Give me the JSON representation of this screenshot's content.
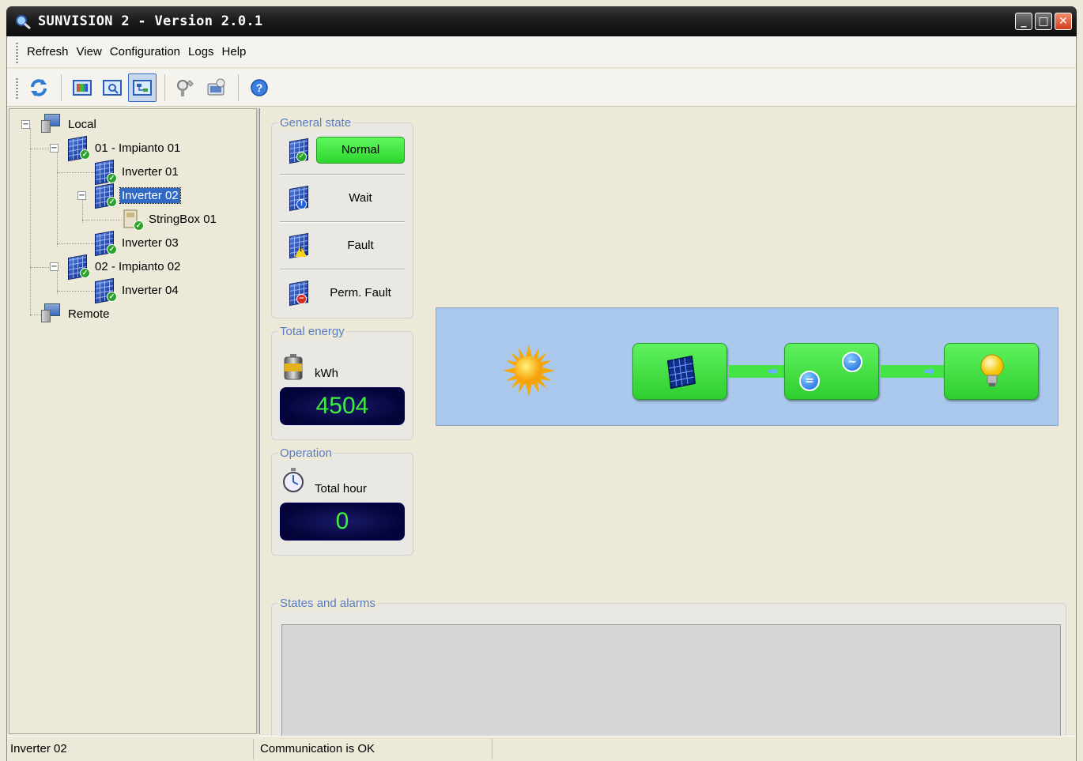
{
  "window": {
    "title": "SUNVISION 2 - Version 2.0.1",
    "buttons": {
      "minimize": "_",
      "maximize": "□",
      "close": "✕"
    }
  },
  "menu": [
    "Refresh",
    "View",
    "Configuration",
    "Logs",
    "Help"
  ],
  "toolbar": {
    "icons": [
      "refresh-icon",
      "view-panel-icon",
      "view-detail-icon",
      "view-tree-icon",
      "tools-icon",
      "config-icon",
      "help-icon"
    ],
    "active": "view-tree-icon"
  },
  "tree": {
    "local": "Local",
    "plant1": "01 - Impianto 01",
    "inv1": "Inverter 01",
    "inv2": "Inverter 02",
    "stringbox": "StringBox 01",
    "inv3": "Inverter 03",
    "plant2": "02 - Impianto 02",
    "inv4": "Inverter 04",
    "remote": "Remote",
    "selected": "Inverter 02"
  },
  "general_state": {
    "title": "General state",
    "normal": "Normal",
    "wait": "Wait",
    "fault": "Fault",
    "perm_fault": "Perm. Fault",
    "active": "Normal"
  },
  "total_energy": {
    "title": "Total energy",
    "unit": "kWh",
    "value": "4504"
  },
  "operation": {
    "title": "Operation",
    "label": "Total hour",
    "value": "0"
  },
  "states_alarms": {
    "title": "States and alarms"
  },
  "statusbar": {
    "device": "Inverter 02",
    "comm": "Communication is OK"
  },
  "colors": {
    "accent": "#316ac5",
    "ok_green": "#2fd62f",
    "lcd_text": "#3cf03c",
    "flow_bg": "#a9c8ec"
  }
}
